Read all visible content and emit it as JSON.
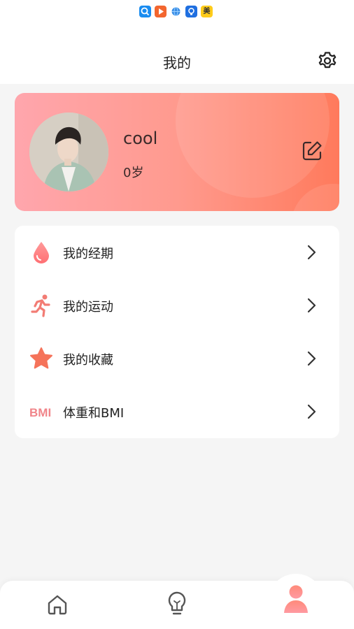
{
  "status_bar": {
    "icons": [
      "search-app-icon",
      "video-app-icon",
      "browser-app-icon",
      "bulb-app-icon",
      "mei-app-icon"
    ],
    "mei_label": "美"
  },
  "header": {
    "title": "我的",
    "settings_icon": "gear-icon"
  },
  "profile": {
    "name": "cool",
    "age": "0岁",
    "edit_icon": "edit-icon",
    "colors": {
      "gradient_start": "#ffa6ad",
      "gradient_end": "#ff7a5c"
    }
  },
  "menu": {
    "items": [
      {
        "label": "我的经期",
        "icon": "drop-icon"
      },
      {
        "label": "我的运动",
        "icon": "running-icon"
      },
      {
        "label": "我的收藏",
        "icon": "star-icon"
      },
      {
        "label": "体重和BMI",
        "icon": "bmi-icon",
        "icon_text": "BMI"
      }
    ]
  },
  "bottom_nav": {
    "items": [
      {
        "icon": "home-icon",
        "active": false
      },
      {
        "icon": "bulb-icon",
        "active": false
      },
      {
        "icon": "user-icon",
        "active": true
      }
    ]
  },
  "colors": {
    "accent": "#ff7a6a",
    "background": "#f5f5f5"
  }
}
